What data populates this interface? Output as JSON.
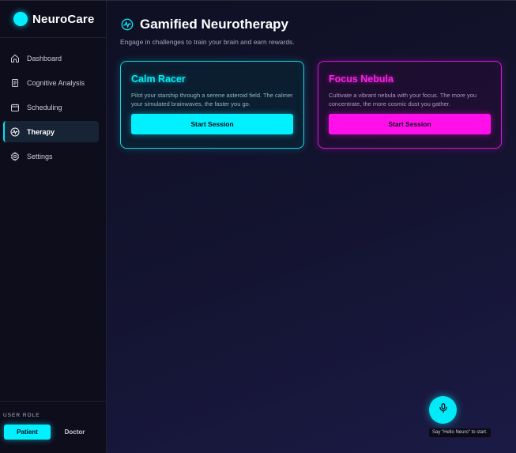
{
  "brand": {
    "name": "NeuroCare",
    "accent": "#00f0ff"
  },
  "sidebar": {
    "items": [
      {
        "label": "Dashboard",
        "icon": "home-icon"
      },
      {
        "label": "Cognitive Analysis",
        "icon": "document-icon"
      },
      {
        "label": "Scheduling",
        "icon": "calendar-icon"
      },
      {
        "label": "Therapy",
        "icon": "brainwave-icon",
        "active": true
      },
      {
        "label": "Settings",
        "icon": "gear-icon"
      }
    ]
  },
  "role": {
    "label": "USER ROLE",
    "options": [
      "Patient",
      "Doctor"
    ],
    "selected": "Patient"
  },
  "header": {
    "title": "Gamified Neurotherapy",
    "subtitle": "Engage in challenges to train your brain and earn rewards."
  },
  "cards": [
    {
      "title": "Calm Racer",
      "description": "Pilot your starship through a serene asteroid field. The calmer your simulated brainwaves, the faster you go.",
      "button": "Start Session",
      "color": "#00f0ff"
    },
    {
      "title": "Focus Nebula",
      "description": "Cultivate a vibrant nebula with your focus. The more you concentrate, the more cosmic dust you gather.",
      "button": "Start Session",
      "color": "#ff10ea"
    }
  ],
  "voice": {
    "hint": "Say \"Hello Neuro\" to start.",
    "icon": "microphone-icon"
  }
}
